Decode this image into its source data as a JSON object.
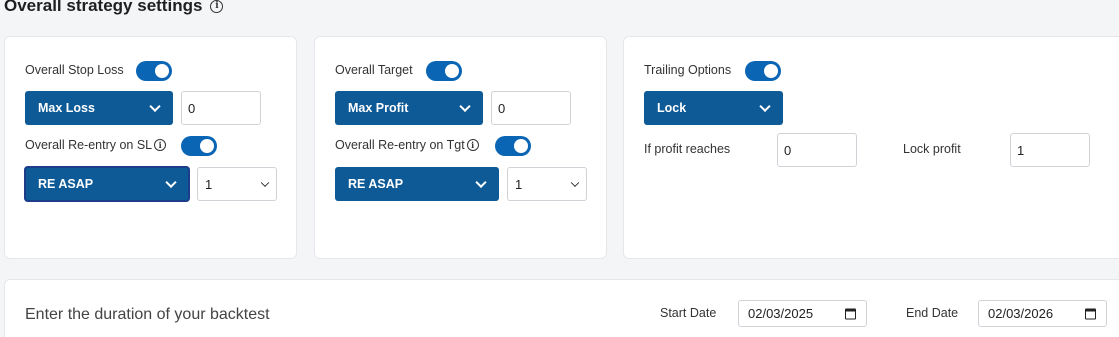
{
  "title": "Overall strategy settings",
  "card_sl": {
    "stop_loss_label": "Overall Stop Loss",
    "stop_loss_type": "Max Loss",
    "stop_loss_value": "0",
    "reentry_label": "Overall Re-entry on SL",
    "reentry_type": "RE ASAP",
    "reentry_count": "1"
  },
  "card_tgt": {
    "target_label": "Overall Target",
    "target_type": "Max Profit",
    "target_value": "0",
    "reentry_label": "Overall Re-entry on Tgt",
    "reentry_type": "RE ASAP",
    "reentry_count": "1"
  },
  "card_trail": {
    "trailing_label": "Trailing Options",
    "trailing_type": "Lock",
    "profit_reaches_label": "If profit reaches",
    "profit_reaches_value": "0",
    "lock_profit_label": "Lock profit",
    "lock_profit_value": "1"
  },
  "duration": {
    "prompt": "Enter the duration of your backtest",
    "start_label": "Start Date",
    "start_value": "02/03/2025",
    "end_label": "End Date",
    "end_value": "02/03/2026"
  },
  "colors": {
    "toggle_on": "#0a66b5",
    "dropdown_bg": "#0d5a96"
  }
}
